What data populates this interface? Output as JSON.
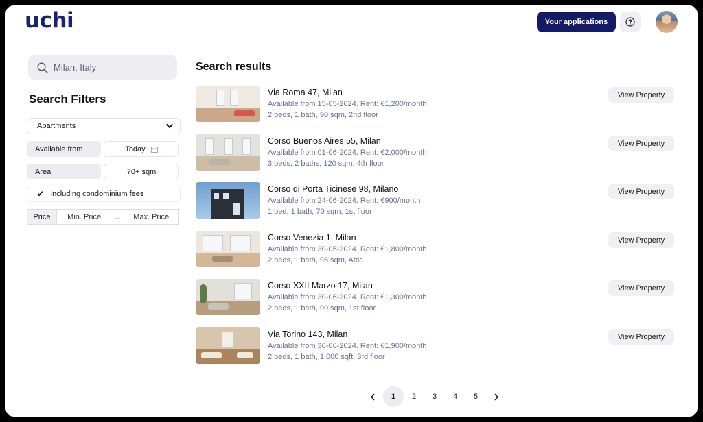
{
  "header": {
    "logo": "uchi",
    "applications_label": "Your applications",
    "help_icon": "question-circle-icon",
    "avatar": "user-avatar"
  },
  "sidebar": {
    "search": {
      "value": "Milan, Italy",
      "icon": "search-icon"
    },
    "filters_title": "Search Filters",
    "property_type": {
      "selected": "Apartments",
      "icon": "chevron-down-icon"
    },
    "available_from": {
      "label": "Available from",
      "value": "Today",
      "icon": "calendar-icon"
    },
    "area": {
      "label": "Area",
      "value": "70+ sqm"
    },
    "condo_fees": {
      "label": "Including condominium fees",
      "checked": true,
      "icon": "check-icon"
    },
    "price": {
      "label": "Price",
      "min_placeholder": "Min. Price",
      "arrow": "→",
      "max_placeholder": "Max. Price"
    }
  },
  "results": {
    "title": "Search results",
    "view_label": "View Property",
    "items": [
      {
        "title": "Via Roma 47, Milan",
        "availability": "Available from 15-05-2024. Rent: €1,200/month",
        "details": "2 beds, 1 bath, 90 sqm, 2nd floor"
      },
      {
        "title": "Corso Buenos Aires 55, Milan",
        "availability": "Available from 01-06-2024. Rent: €2,000/month",
        "details": "3 beds, 2 baths, 120 sqm, 4th floor"
      },
      {
        "title": "Corso di Porta Ticinese 98, Milano",
        "availability": "Available from 24-06-2024. Rent: €900/month",
        "details": "1 bed, 1 bath, 70 sqm, 1st floor"
      },
      {
        "title": "Corso Venezia 1, Milan",
        "availability": "Available from 30-05-2024. Rent: €1,800/month",
        "details": "2 beds, 1 bath, 95 sqm, Attic"
      },
      {
        "title": "Corso XXII Marzo 17, Milan",
        "availability": "Available from 30-06-2024. Rent: €1,300/month",
        "details": "2 beds, 1 bath, 90 sqm, 1st floor"
      },
      {
        "title": "Via Torino 143, Milan",
        "availability": "Available from 30-06-2024. Rent: €1,900/month",
        "details": "2 beds, 1 bath, 1,000 sqft, 3rd floor"
      }
    ]
  },
  "pagination": {
    "prev_icon": "chevron-left-icon",
    "next_icon": "chevron-right-icon",
    "pages": [
      "1",
      "2",
      "3",
      "4",
      "5"
    ],
    "current": "1"
  },
  "colors": {
    "brand": "#1b2370",
    "primary_button": "#131a66",
    "muted_text": "#6b6f98"
  }
}
